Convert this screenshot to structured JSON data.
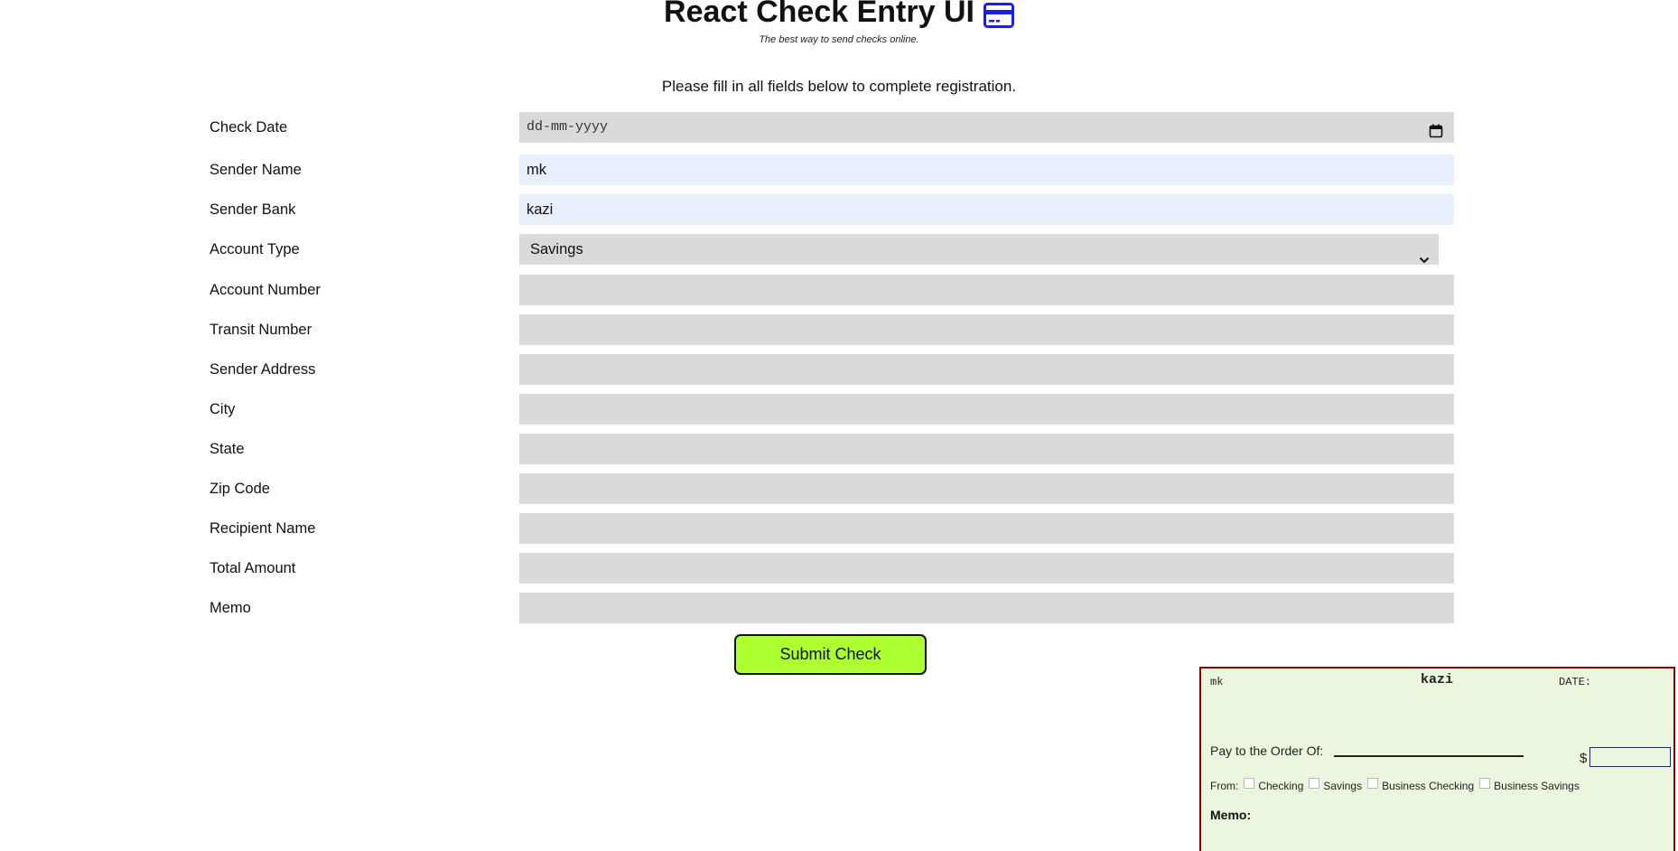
{
  "header": {
    "title": "React Check Entry UI",
    "title_icon": "credit-card-icon",
    "subtitle": "The best way to send checks online.",
    "instructions": "Please fill in all fields below to complete registration."
  },
  "form": {
    "check_date": {
      "label": "Check Date",
      "placeholder": "dd-mm-yyyy",
      "icon": "calendar-icon"
    },
    "sender_name": {
      "label": "Sender Name",
      "value": "mk"
    },
    "sender_bank": {
      "label": "Sender Bank",
      "value": "kazi"
    },
    "account_type": {
      "label": "Account Type",
      "value": "Savings",
      "icon": "chevron-down-icon"
    },
    "account_number": {
      "label": "Account Number",
      "value": ""
    },
    "transit_number": {
      "label": "Transit Number",
      "value": ""
    },
    "sender_address": {
      "label": "Sender Address",
      "value": ""
    },
    "city": {
      "label": "City",
      "value": ""
    },
    "state": {
      "label": "State",
      "value": ""
    },
    "zip_code": {
      "label": "Zip Code",
      "value": ""
    },
    "recipient_name": {
      "label": "Recipient Name",
      "value": ""
    },
    "total_amount": {
      "label": "Total Amount",
      "value": ""
    },
    "memo": {
      "label": "Memo",
      "value": ""
    },
    "submit_label": "Submit Check"
  },
  "check_preview": {
    "sender": "mk",
    "bank": "kazi",
    "date_label": "DATE:",
    "pay_label": "Pay to the Order Of:",
    "dollar": "$",
    "from_label": "From:",
    "account_options": [
      "Checking",
      "Savings",
      "Business Checking",
      "Business Savings"
    ],
    "memo_label": "Memo:"
  },
  "colors": {
    "field_bg": "#dadada",
    "autofill_bg": "#e8f0fe",
    "submit_bg": "#adff2f",
    "check_bg": "#eaf7de",
    "check_border": "#8b0000",
    "icon_blue": "#1a1aff"
  }
}
